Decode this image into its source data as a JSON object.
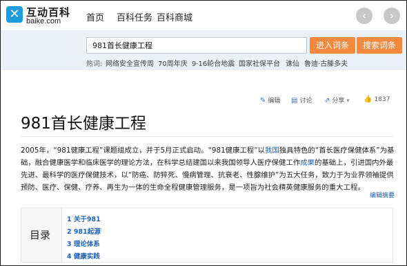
{
  "header": {
    "logo_cn": "互动百科",
    "logo_en": "baike.com",
    "nav": [
      "首页",
      "百科任务",
      "百科商城"
    ],
    "back_icon": "chevron-left-icon",
    "forward_icon": "chevron-right-icon"
  },
  "search": {
    "value": "981首长健康工程",
    "enter_label": "进入词条",
    "search_label": "搜索词条",
    "hot_label": "热词:",
    "hot_items": [
      "网络安全宣传周",
      "70周年庆",
      "9·16轮台地震",
      "国家社保平台",
      "诛仙",
      "鲁迪·古滕多夫"
    ]
  },
  "article": {
    "actions": {
      "edit": "编辑",
      "discuss": "讨论",
      "share": "分享",
      "likes": "1837"
    },
    "title": "981首长健康工程",
    "para_1": "2005年，“981健康工程”课题组成立，并于5月正式启动。“981健康工程”以",
    "link_1": "我国",
    "para_2": "独具特色的“首长医疗保健体系”为基础，融合健康医学和临床医学的理论方法，在科学总结建国以来我国领导人医疗保健工作",
    "link_2": "成果",
    "para_3": "的基础上，引进国内外最先进、最科学的医疗保健技术，以“防癌、防猝死、慢病管理、抗衰老、性腺维护”为五大任务，致力于为业界领袖提供预防、医疗、保健、疗养、再生为一体的生命全程健康管理服务，是一项旨为社会精英健康服务的重大工程。",
    "edit_summary": "编辑摘要"
  },
  "toc": {
    "label": "目录",
    "items": [
      "1  关于981",
      "2  981起源",
      "3  理论体系",
      "4  健康实践"
    ]
  },
  "colors": {
    "accent_orange": "#f2893e",
    "link_blue": "#1d63b8",
    "logo_blue": "#1d9ce0"
  }
}
